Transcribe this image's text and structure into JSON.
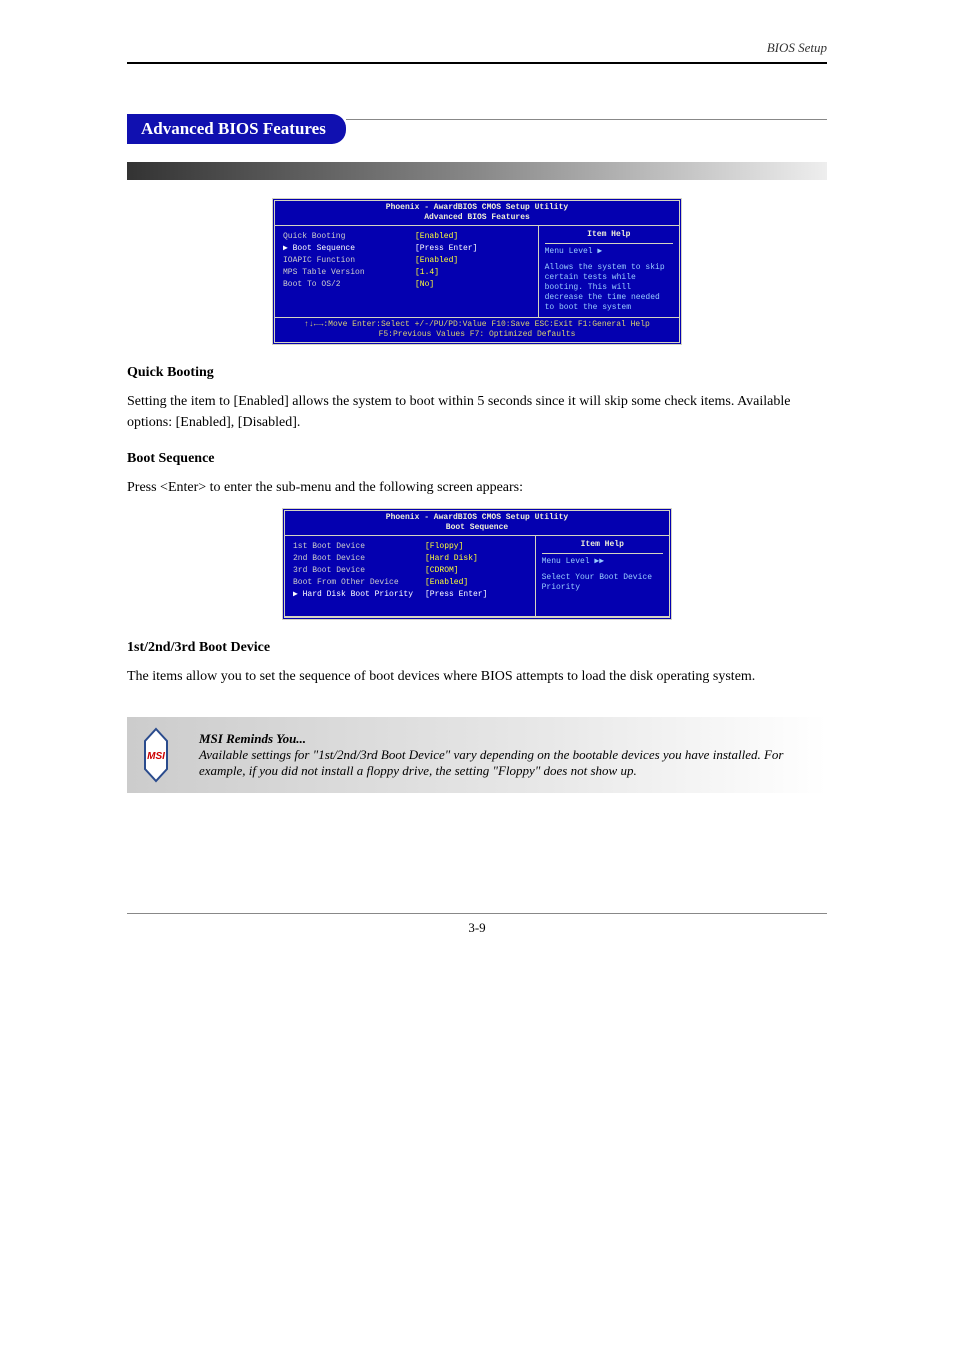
{
  "page": {
    "number": "3-9",
    "running_head": "BIOS Setup",
    "section_title": "Advanced BIOS Features"
  },
  "bios1": {
    "title1": "Phoenix - AwardBIOS CMOS Setup Utility",
    "title2": "Advanced BIOS Features",
    "rows": [
      {
        "label": "Quick Booting",
        "value": "[Enabled]"
      },
      {
        "label": "▶ Boot Sequence",
        "value": "[Press Enter]",
        "white": true
      },
      {
        "label": "IOAPIC Function",
        "value": "[Enabled]"
      },
      {
        "label": "MPS Table Version",
        "value": "[1.4]"
      },
      {
        "label": "Boot To OS/2",
        "value": "[No]"
      }
    ],
    "help_head": "Item Help",
    "help_menu": "Menu Level  ▶",
    "help_body": "Allows the system to skip certain tests while booting. This will decrease the time needed to boot the system",
    "footer1": "↑↓←→:Move  Enter:Select  +/-/PU/PD:Value  F10:Save  ESC:Exit  F1:General Help",
    "footer2": "F5:Previous Values               F7: Optimized Defaults"
  },
  "para1_label": "Quick Booting",
  "para1": "Setting the item to [Enabled] allows the system to boot within 5 seconds since it will skip some check items. Available options: [Enabled], [Disabled].",
  "para2_label": "Boot Sequence",
  "para2": "Press <Enter> to enter the sub-menu and the following screen appears:",
  "bios2": {
    "title1": "Phoenix - AwardBIOS CMOS Setup Utility",
    "title2": "Boot Sequence",
    "rows": [
      {
        "label": "1st Boot Device",
        "value": "[Floppy]"
      },
      {
        "label": "2nd Boot Device",
        "value": "[Hard Disk]"
      },
      {
        "label": "3rd Boot Device",
        "value": "[CDROM]"
      },
      {
        "label": "Boot From Other Device",
        "value": "[Enabled]"
      },
      {
        "label": "▶ Hard Disk Boot Priority",
        "value": "[Press Enter]",
        "white": true
      }
    ],
    "help_head": "Item Help",
    "help_menu": "Menu Level  ▶▶",
    "help_body": "Select Your Boot Device Priority"
  },
  "para3_label": "1st/2nd/3rd Boot Device",
  "para3": "The items allow you to set the sequence of boot devices where BIOS attempts to load the disk operating system.",
  "note_label": "MSI Reminds You...",
  "note_body": "Available settings for \"1st/2nd/3rd Boot Device\" vary depending on the bootable devices you have installed. For example, if you did not install a floppy drive, the setting \"Floppy\" does not show up."
}
